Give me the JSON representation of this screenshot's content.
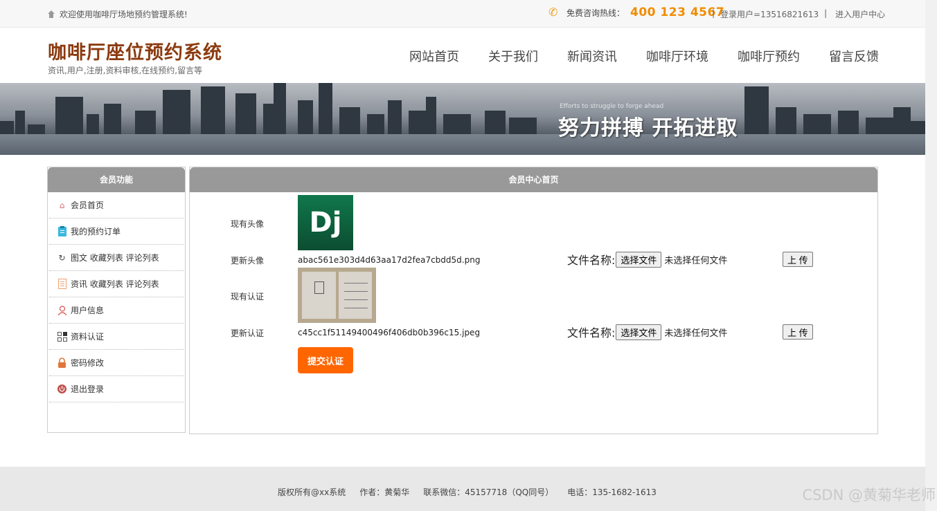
{
  "topbar": {
    "welcome": "欢迎使用咖啡厅场地预约管理系统!",
    "hotline_label": "免费咨询热线：",
    "hotline_number": "400 123 4567",
    "login_user": "登录用户=13516821613",
    "separator": "|",
    "user_center": "进入用户中心"
  },
  "header": {
    "title": "咖啡厅座位预约系统",
    "subtitle": "资讯,用户,注册,资料审核,在线预约,留言等",
    "nav": [
      "网站首页",
      "关于我们",
      "新闻资讯",
      "咖啡厅环境",
      "咖啡厅预约",
      "留言反馈"
    ]
  },
  "banner": {
    "slogan_en": "Efforts to struggle to forge ahead",
    "slogan": "努力拼搏 开拓进取"
  },
  "sidebar": {
    "title": "会员功能",
    "items": [
      {
        "label": "会员首页",
        "icon": "home-icon"
      },
      {
        "label": "我的预约订单",
        "icon": "clipboard-icon"
      },
      {
        "label": "图文 收藏列表 评论列表",
        "icon": "history-icon"
      },
      {
        "label": "资讯 收藏列表 评论列表",
        "icon": "document-icon"
      },
      {
        "label": "用户信息",
        "icon": "user-icon"
      },
      {
        "label": "资料认证",
        "icon": "grid-icon"
      },
      {
        "label": "密码修改",
        "icon": "lock-icon"
      },
      {
        "label": "退出登录",
        "icon": "power-icon"
      }
    ]
  },
  "main": {
    "title": "会员中心首页",
    "current_avatar_label": "现有头像",
    "avatar_text": "Dj",
    "update_avatar_label": "更新头像",
    "avatar_filename": "abac561e303d4d63aa17d2fea7cbdd5d.png",
    "current_cert_label": "现有认证",
    "update_cert_label": "更新认证",
    "cert_filename": "c45cc1f51149400496f406db0b396c15.jpeg",
    "file_name_label": "文件名称:",
    "choose_file": "选择文件",
    "no_file": "未选择任何文件",
    "upload": "上 传",
    "submit": "提交认证"
  },
  "footer": {
    "copyright": "版权所有@xx系统",
    "author": "作者：黄菊华",
    "wechat": "联系微信：45157718（QQ同号）",
    "phone": "电话：135-1682-1613"
  },
  "watermark": "CSDN @黄菊华老师"
}
